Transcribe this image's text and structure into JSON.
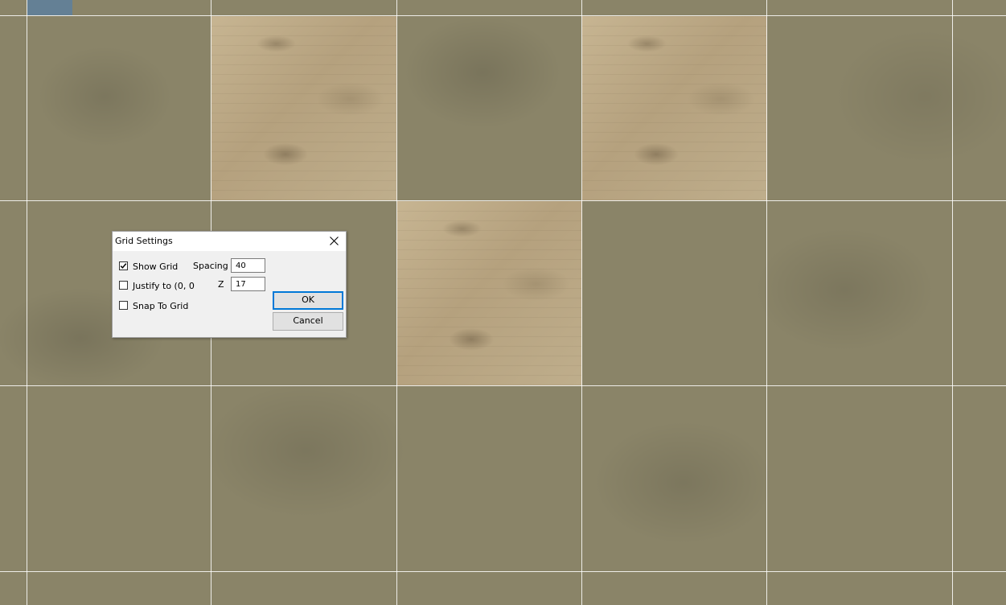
{
  "dialog": {
    "title": "Grid Settings",
    "show_grid": {
      "label": "Show Grid",
      "checked": true
    },
    "justify": {
      "label": "Justify to (0, 0",
      "checked": false
    },
    "snap": {
      "label": "Snap To Grid",
      "checked": false
    },
    "spacing": {
      "label": "Spacing",
      "value": "40"
    },
    "z": {
      "label": "Z",
      "value": "17"
    },
    "ok_label": "OK",
    "cancel_label": "Cancel"
  }
}
